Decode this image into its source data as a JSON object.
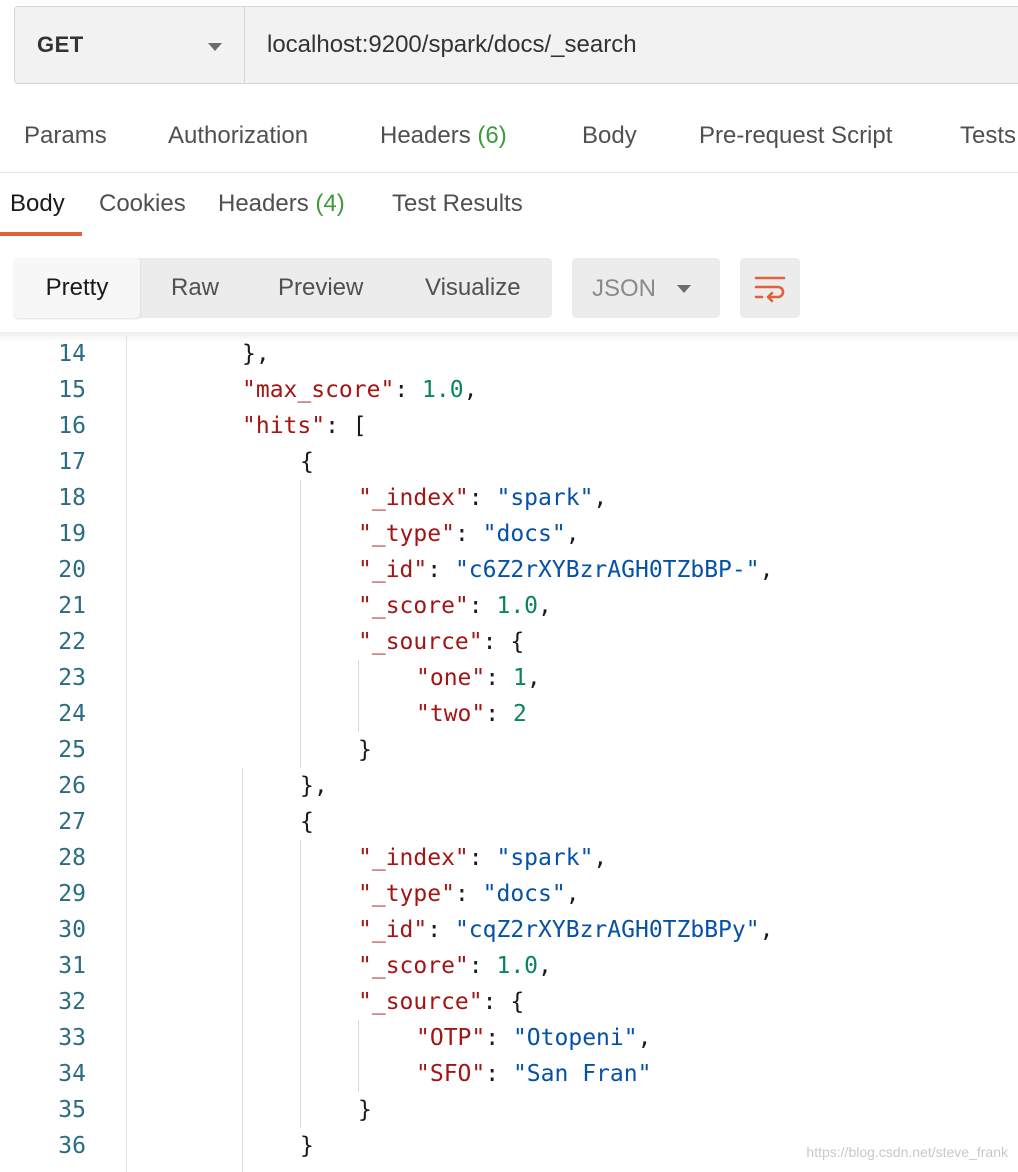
{
  "request": {
    "method": "GET",
    "url": "localhost:9200/spark/docs/_search"
  },
  "request_tabs": [
    {
      "label": "Params",
      "count": ""
    },
    {
      "label": "Authorization",
      "count": ""
    },
    {
      "label": "Headers",
      "count": "(6)"
    },
    {
      "label": "Body",
      "count": ""
    },
    {
      "label": "Pre-request Script",
      "count": ""
    },
    {
      "label": "Tests",
      "count": ""
    }
  ],
  "response_tabs": [
    {
      "label": "Body",
      "count": "",
      "active": true
    },
    {
      "label": "Cookies",
      "count": ""
    },
    {
      "label": "Headers",
      "count": "(4)"
    },
    {
      "label": "Test Results",
      "count": ""
    }
  ],
  "format": {
    "modes": [
      "Pretty",
      "Raw",
      "Preview",
      "Visualize"
    ],
    "active": "Pretty",
    "language": "JSON",
    "wrap_icon": "wrap-lines-icon"
  },
  "colors": {
    "accent": "#e0613b",
    "count_green": "#3d9a3d",
    "json_key": "#a31515",
    "json_string": "#0451a5",
    "json_number": "#098658",
    "line_number": "#2a6c80"
  },
  "code_lines": [
    {
      "n": "14",
      "indent": 2,
      "tokens": [
        {
          "t": "p",
          "v": "},"
        }
      ]
    },
    {
      "n": "15",
      "indent": 2,
      "tokens": [
        {
          "t": "k",
          "v": "\"max_score\""
        },
        {
          "t": "p",
          "v": ": "
        },
        {
          "t": "n",
          "v": "1.0"
        },
        {
          "t": "p",
          "v": ","
        }
      ]
    },
    {
      "n": "16",
      "indent": 2,
      "tokens": [
        {
          "t": "k",
          "v": "\"hits\""
        },
        {
          "t": "p",
          "v": ": ["
        }
      ]
    },
    {
      "n": "17",
      "indent": 3,
      "tokens": [
        {
          "t": "p",
          "v": "{"
        }
      ]
    },
    {
      "n": "18",
      "indent": 4,
      "tokens": [
        {
          "t": "k",
          "v": "\"_index\""
        },
        {
          "t": "p",
          "v": ": "
        },
        {
          "t": "s",
          "v": "\"spark\""
        },
        {
          "t": "p",
          "v": ","
        }
      ]
    },
    {
      "n": "19",
      "indent": 4,
      "tokens": [
        {
          "t": "k",
          "v": "\"_type\""
        },
        {
          "t": "p",
          "v": ": "
        },
        {
          "t": "s",
          "v": "\"docs\""
        },
        {
          "t": "p",
          "v": ","
        }
      ]
    },
    {
      "n": "20",
      "indent": 4,
      "tokens": [
        {
          "t": "k",
          "v": "\"_id\""
        },
        {
          "t": "p",
          "v": ": "
        },
        {
          "t": "s",
          "v": "\"c6Z2rXYBzrAGH0TZbBP-\""
        },
        {
          "t": "p",
          "v": ","
        }
      ]
    },
    {
      "n": "21",
      "indent": 4,
      "tokens": [
        {
          "t": "k",
          "v": "\"_score\""
        },
        {
          "t": "p",
          "v": ": "
        },
        {
          "t": "n",
          "v": "1.0"
        },
        {
          "t": "p",
          "v": ","
        }
      ]
    },
    {
      "n": "22",
      "indent": 4,
      "tokens": [
        {
          "t": "k",
          "v": "\"_source\""
        },
        {
          "t": "p",
          "v": ": {"
        }
      ]
    },
    {
      "n": "23",
      "indent": 5,
      "tokens": [
        {
          "t": "k",
          "v": "\"one\""
        },
        {
          "t": "p",
          "v": ": "
        },
        {
          "t": "n",
          "v": "1"
        },
        {
          "t": "p",
          "v": ","
        }
      ]
    },
    {
      "n": "24",
      "indent": 5,
      "tokens": [
        {
          "t": "k",
          "v": "\"two\""
        },
        {
          "t": "p",
          "v": ": "
        },
        {
          "t": "n",
          "v": "2"
        }
      ]
    },
    {
      "n": "25",
      "indent": 4,
      "tokens": [
        {
          "t": "p",
          "v": "}"
        }
      ]
    },
    {
      "n": "26",
      "indent": 3,
      "tokens": [
        {
          "t": "p",
          "v": "},"
        }
      ]
    },
    {
      "n": "27",
      "indent": 3,
      "tokens": [
        {
          "t": "p",
          "v": "{"
        }
      ]
    },
    {
      "n": "28",
      "indent": 4,
      "tokens": [
        {
          "t": "k",
          "v": "\"_index\""
        },
        {
          "t": "p",
          "v": ": "
        },
        {
          "t": "s",
          "v": "\"spark\""
        },
        {
          "t": "p",
          "v": ","
        }
      ]
    },
    {
      "n": "29",
      "indent": 4,
      "tokens": [
        {
          "t": "k",
          "v": "\"_type\""
        },
        {
          "t": "p",
          "v": ": "
        },
        {
          "t": "s",
          "v": "\"docs\""
        },
        {
          "t": "p",
          "v": ","
        }
      ]
    },
    {
      "n": "30",
      "indent": 4,
      "tokens": [
        {
          "t": "k",
          "v": "\"_id\""
        },
        {
          "t": "p",
          "v": ": "
        },
        {
          "t": "s",
          "v": "\"cqZ2rXYBzrAGH0TZbBPy\""
        },
        {
          "t": "p",
          "v": ","
        }
      ]
    },
    {
      "n": "31",
      "indent": 4,
      "tokens": [
        {
          "t": "k",
          "v": "\"_score\""
        },
        {
          "t": "p",
          "v": ": "
        },
        {
          "t": "n",
          "v": "1.0"
        },
        {
          "t": "p",
          "v": ","
        }
      ]
    },
    {
      "n": "32",
      "indent": 4,
      "tokens": [
        {
          "t": "k",
          "v": "\"_source\""
        },
        {
          "t": "p",
          "v": ": {"
        }
      ]
    },
    {
      "n": "33",
      "indent": 5,
      "tokens": [
        {
          "t": "k",
          "v": "\"OTP\""
        },
        {
          "t": "p",
          "v": ": "
        },
        {
          "t": "s",
          "v": "\"Otopeni\""
        },
        {
          "t": "p",
          "v": ","
        }
      ]
    },
    {
      "n": "34",
      "indent": 5,
      "tokens": [
        {
          "t": "k",
          "v": "\"SFO\""
        },
        {
          "t": "p",
          "v": ": "
        },
        {
          "t": "s",
          "v": "\"San Fran\""
        }
      ]
    },
    {
      "n": "35",
      "indent": 4,
      "tokens": [
        {
          "t": "p",
          "v": "}"
        }
      ]
    },
    {
      "n": "36",
      "indent": 3,
      "tokens": [
        {
          "t": "p",
          "v": "}"
        }
      ]
    }
  ],
  "watermark": "https://blog.csdn.net/steve_frank"
}
